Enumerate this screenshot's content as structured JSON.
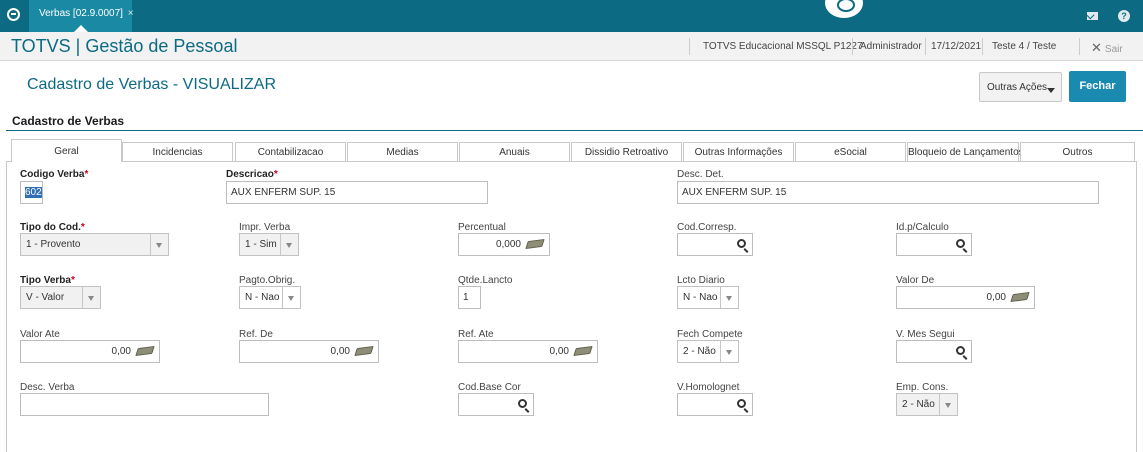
{
  "topbar": {
    "tab_label": "Verbas [02.9.0007]",
    "tab_close": "×",
    "help": "?"
  },
  "header": {
    "app_title": "TOTVS | Gestão de Pessoal",
    "env": "TOTVS Educacional MSSQL P1227",
    "user": "Administrador",
    "date": "17/12/2021",
    "company": "Teste 4 / Teste",
    "exit_label": "Sair"
  },
  "page": {
    "title": "Cadastro de Verbas - VISUALIZAR",
    "other_actions": "Outras Ações",
    "close": "Fechar",
    "section": "Cadastro de Verbas"
  },
  "tabs": [
    "Geral",
    "Incidencias",
    "Contabilizacao",
    "Medias",
    "Anuais",
    "Dissidio Retroativo",
    "Outras Informações",
    "eSocial",
    "Bloqueio de Lançamentos",
    "Outros"
  ],
  "form": {
    "codigo_verba": {
      "label": "Codigo Verba",
      "value": "602"
    },
    "descricao": {
      "label": "Descricao",
      "value": "AUX ENFERM SUP. 15"
    },
    "desc_det": {
      "label": "Desc. Det.",
      "value": "AUX ENFERM SUP. 15"
    },
    "tipo_cod": {
      "label": "Tipo do Cod.",
      "value": "1 - Provento"
    },
    "impr_verba": {
      "label": "Impr. Verba",
      "value": "1 - Sim"
    },
    "percentual": {
      "label": "Percentual",
      "value": "0,000"
    },
    "cod_corresp": {
      "label": "Cod.Corresp.",
      "value": ""
    },
    "id_calculo": {
      "label": "Id.p/Calculo",
      "value": ""
    },
    "tipo_verba": {
      "label": "Tipo Verba",
      "value": "V - Valor"
    },
    "pagto_obrig": {
      "label": "Pagto.Obrig.",
      "value": "N - Nao"
    },
    "qtde_lancto": {
      "label": "Qtde.Lancto",
      "value": "1"
    },
    "lcto_diario": {
      "label": "Lcto Diario",
      "value": "N - Nao"
    },
    "valor_de": {
      "label": "Valor De",
      "value": "0,00"
    },
    "valor_ate": {
      "label": "Valor Ate",
      "value": "0,00"
    },
    "ref_de": {
      "label": "Ref. De",
      "value": "0,00"
    },
    "ref_ate": {
      "label": "Ref. Ate",
      "value": "0,00"
    },
    "fech_compete": {
      "label": "Fech Compete",
      "value": "2 - Não"
    },
    "v_mes_segui": {
      "label": "V. Mes Segui",
      "value": ""
    },
    "desc_verba": {
      "label": "Desc. Verba",
      "value": ""
    },
    "cod_base_cor": {
      "label": "Cod.Base Cor",
      "value": ""
    },
    "v_homolognet": {
      "label": "V.Homolognet",
      "value": ""
    },
    "emp_cons": {
      "label": "Emp. Cons.",
      "value": "2 - Não"
    }
  },
  "required_marker": "*",
  "colors": {
    "brand": "#0c6a82",
    "primary_button": "#1b8ab0",
    "required": "#d0021b"
  }
}
